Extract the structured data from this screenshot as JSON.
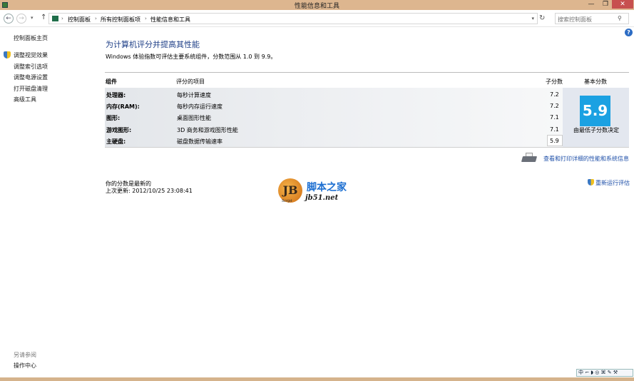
{
  "window": {
    "title": "性能信息和工具",
    "min": "—",
    "max": "❐",
    "close": "✕"
  },
  "address": {
    "crumbs": [
      "控制面板",
      "所有控制面板项",
      "性能信息和工具"
    ],
    "search_placeholder": "搜索控制面板"
  },
  "sidebar": {
    "home": "控制面板主页",
    "items": [
      "调整视觉效果",
      "调整索引选项",
      "调整电源设置",
      "打开磁盘清理",
      "高级工具"
    ],
    "see_also": "另请参阅",
    "action_center": "操作中心"
  },
  "main": {
    "heading": "为计算机评分并提高其性能",
    "description": "Windows 体验指数可评估主要系统组件，分数范围从 1.0 到 9.9。",
    "table": {
      "headers": {
        "component": "组件",
        "item": "评分的项目",
        "subscore": "子分数",
        "base": "基本分数"
      },
      "rows": [
        {
          "component": "处理器:",
          "item": "每秒计算速度",
          "score": "7.2"
        },
        {
          "component": "内存(RAM):",
          "item": "每秒内存运行速度",
          "score": "7.2"
        },
        {
          "component": "图形:",
          "item": "桌面图形性能",
          "score": "7.1"
        },
        {
          "component": "游戏图形:",
          "item": "3D 商务和游戏图形性能",
          "score": "7.1"
        },
        {
          "component": "主硬盘:",
          "item": "磁盘数据传输速率",
          "score": "5.9"
        }
      ],
      "base_score": "5.9",
      "base_caption": "由最低子分数决定"
    },
    "detail_link": "查看和打印详细的性能和系统信息",
    "status_current": "你的分数是最新的",
    "last_update": "上次更新: 2012/10/25 23:08:41",
    "rerun": "重新运行评估"
  },
  "watermark": {
    "logo": "JB",
    "script": "Script",
    "name": "脚本之家",
    "url": "jb51.net"
  },
  "ime": "中 ⌐ ◗ ◎ ⌘ ✎ ⚒"
}
